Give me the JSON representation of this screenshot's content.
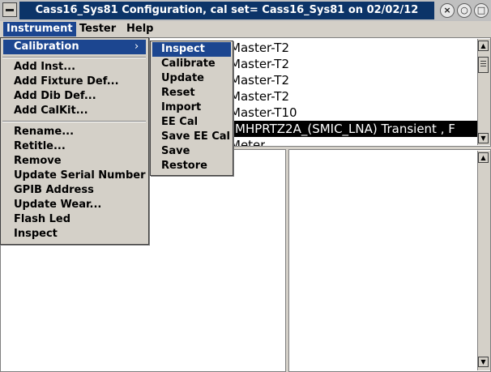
{
  "window": {
    "title": "Cass16_Sys81 Configuration,  cal set= Cass16_Sys81 on 02/02/12",
    "controls": {
      "close": "×",
      "minimize": "○",
      "maximize": "□"
    }
  },
  "menubar": {
    "instrument": "Instrument",
    "tester": "Tester",
    "help": "Help"
  },
  "instrument_menu": {
    "calibration": "Calibration",
    "submenu_arrow": "›",
    "items": [
      "Add Inst...",
      "Add Fixture Def...",
      "Add Dib Def...",
      "Add CalKit...",
      "Rename...",
      "Retitle...",
      "Remove",
      "Update Serial Number",
      "GPIB Address",
      "Update Wear...",
      "Flash Led",
      "Inspect"
    ]
  },
  "calibration_submenu": {
    "items": [
      "Inspect",
      "Calibrate",
      "Update",
      "Reset",
      "Import",
      "EE Cal",
      "Save EE Cal",
      "Save",
      "Restore"
    ]
  },
  "list": {
    "rows": [
      "Master-T2",
      "Master-T2",
      "Master-T2",
      "Master-T2",
      "Master-T10",
      "MHPRTZ2A_(SMIC_LNA) Transient , F",
      "Meter"
    ],
    "selected_index": 5
  },
  "scroll": {
    "up": "▲",
    "down": "▼"
  }
}
